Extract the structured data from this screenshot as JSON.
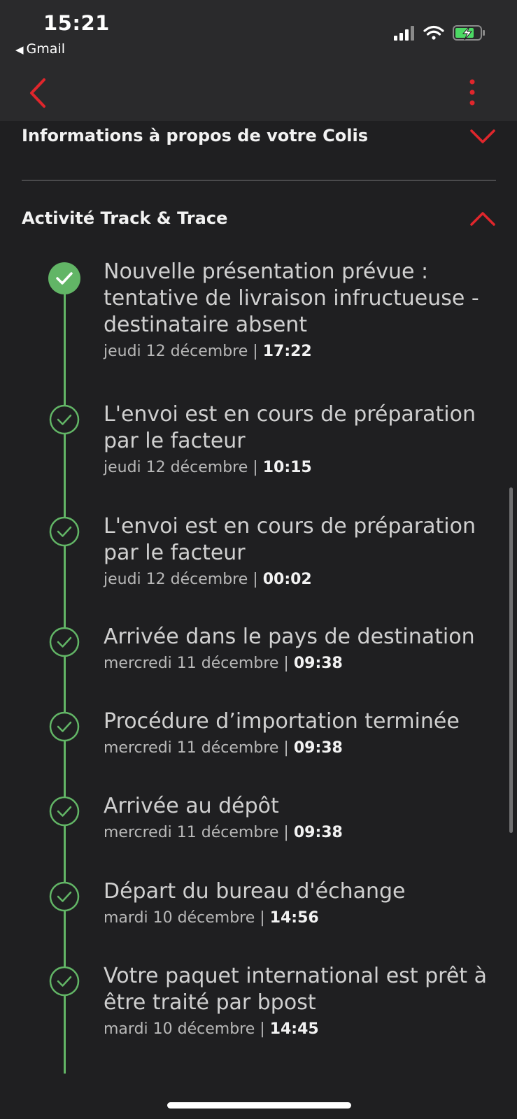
{
  "status_bar": {
    "time": "15:21",
    "back_app": "Gmail"
  },
  "sections": {
    "info": {
      "title": "Informations à propos de votre Colis",
      "expanded": false
    },
    "activity": {
      "title": "Activité Track & Trace",
      "expanded": true
    }
  },
  "events": [
    {
      "description": "Nouvelle présentation prévue : tentative de livraison infructueuse - destinataire absent",
      "date": "jeudi 12 décembre",
      "separator": "|",
      "time": "17:22",
      "current": true
    },
    {
      "description": "L'envoi est en cours de préparation par le facteur",
      "date": "jeudi 12 décembre",
      "separator": "|",
      "time": "10:15"
    },
    {
      "description": "L'envoi est en cours de préparation par le facteur",
      "date": "jeudi 12 décembre",
      "separator": "|",
      "time": "00:02"
    },
    {
      "description": "Arrivée dans le pays de destination",
      "date": "mercredi 11 décembre",
      "separator": "|",
      "time": "09:38"
    },
    {
      "description": "Procédure d’importation terminée",
      "date": "mercredi 11 décembre",
      "separator": "|",
      "time": "09:38"
    },
    {
      "description": "Arrivée au dépôt",
      "date": "mercredi 11 décembre",
      "separator": "|",
      "time": "09:38"
    },
    {
      "description": "Départ du bureau d'échange",
      "date": "mardi 10 décembre",
      "separator": "|",
      "time": "14:56"
    },
    {
      "description": "Votre paquet international est prêt à être traité par bpost",
      "date": "mardi 10 décembre",
      "separator": "|",
      "time": "14:45"
    }
  ],
  "colors": {
    "accent": "#e0262c",
    "timeline": "#62b566",
    "background": "#1f1f21",
    "topbar": "#2a2a2c"
  },
  "icons": {
    "nav_back": "chevron-left-icon",
    "nav_more": "more-vertical-icon",
    "info_toggle": "chevron-down-icon",
    "activity_toggle": "chevron-up-icon",
    "event_marker": "check-circle-icon"
  }
}
